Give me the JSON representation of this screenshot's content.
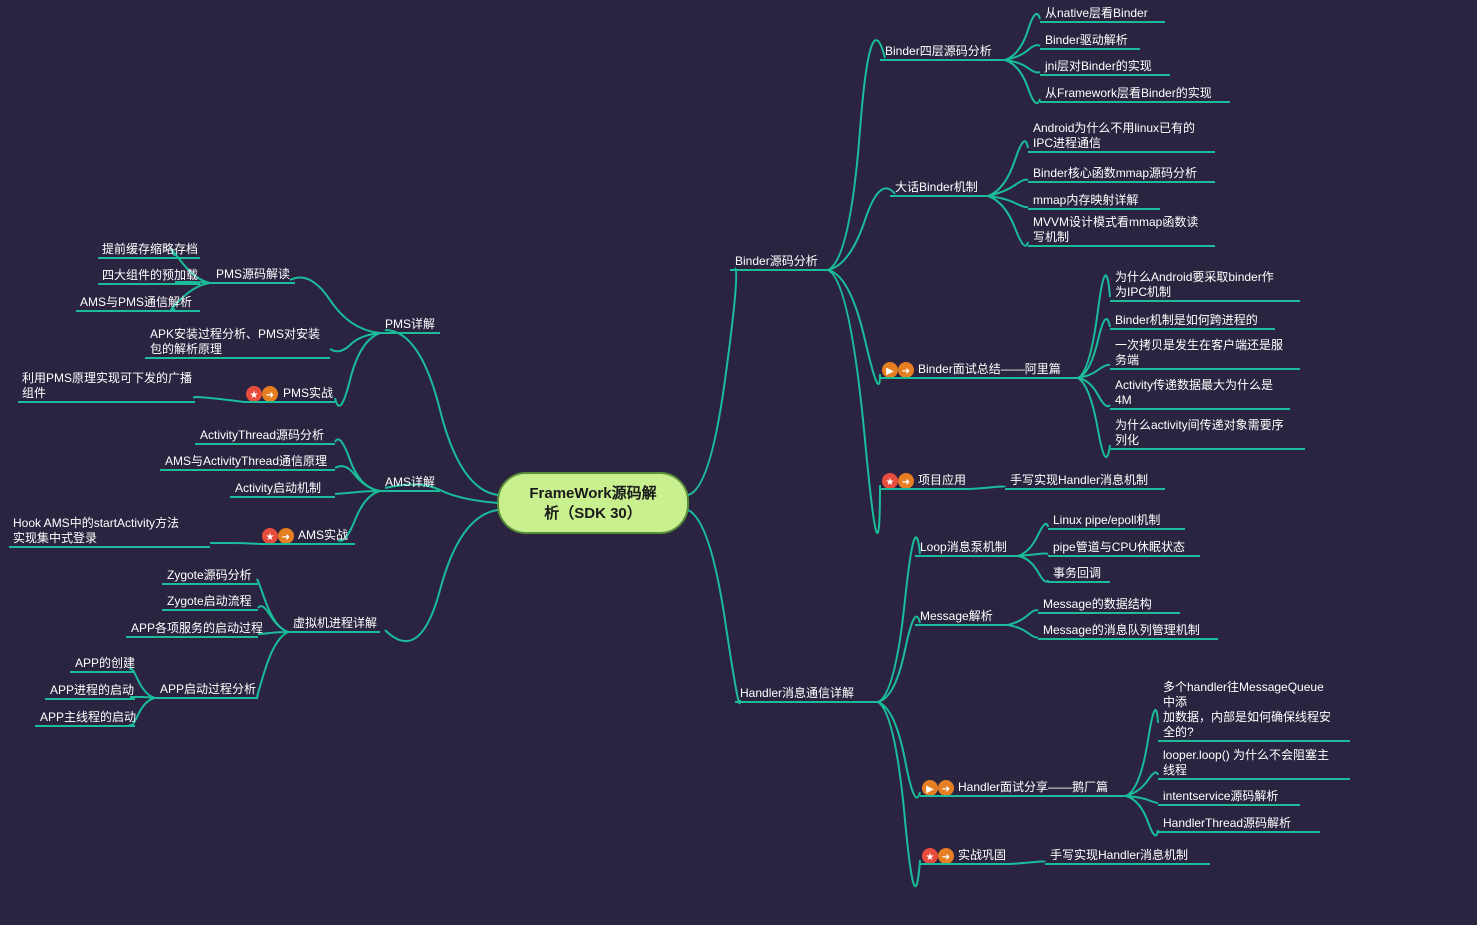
{
  "central": {
    "line1": "FrameWork源码解",
    "line2": "析（SDK 30）"
  },
  "left": {
    "pms": {
      "title": "PMS详解",
      "b1": {
        "title": "PMS源码解读",
        "items": [
          "提前缓存缩略存档",
          "四大组件的预加载",
          "AMS与PMS通信解析"
        ]
      },
      "b2": {
        "title": "APK安装过程分析、PMS对安装包的解析原理"
      },
      "b3": {
        "title": "PMS实战",
        "items": [
          "利用PMS原理实现可下发的广播组件"
        ]
      }
    },
    "ams": {
      "title": "AMS详解",
      "b1": {
        "items": [
          "ActivityThread源码分析",
          "AMS与ActivityThread通信原理",
          "Activity启动机制"
        ]
      },
      "b2": {
        "title": "AMS实战",
        "items": [
          "Hook AMS中的startActivity方法实现集中式登录"
        ]
      }
    },
    "vm": {
      "title": "虚拟机进程详解",
      "b1": {
        "items": [
          "Zygote源码分析",
          "Zygote启动流程",
          "APP各项服务的启动过程"
        ]
      },
      "b2": {
        "title": "APP启动过程分析",
        "items": [
          "APP的创建",
          "APP进程的启动",
          "APP主线程的启动"
        ]
      }
    }
  },
  "right": {
    "binder": {
      "title": "Binder源码分析",
      "b1": {
        "title": "Binder四层源码分析",
        "items": [
          "从native层看Binder",
          "Binder驱动解析",
          "jni层对Binder的实现",
          "从Framework层看Binder的实现"
        ]
      },
      "b2": {
        "title": "大话Binder机制",
        "items": [
          "Android为什么不用linux已有的IPC进程通信",
          "Binder核心函数mmap源码分析",
          "mmap内存映射详解",
          "MVVM设计模式看mmap函数读写机制"
        ]
      },
      "b3": {
        "title": "Binder面试总结——阿里篇",
        "items": [
          "为什么Android要采取binder作为IPC机制",
          "Binder机制是如何跨进程的",
          "一次拷贝是发生在客户端还是服务端",
          "Activity传递数据最大为什么是4M",
          "为什么activity间传递对象需要序列化"
        ]
      },
      "b4": {
        "title": "项目应用",
        "items": [
          "手写实现Handler消息机制"
        ]
      }
    },
    "handler": {
      "title": "Handler消息通信详解",
      "b1": {
        "title": "Loop消息泵机制",
        "items": [
          "Linux pipe/epoll机制",
          "pipe管道与CPU休眠状态",
          "事务回调"
        ]
      },
      "b2": {
        "title": "Message解析",
        "items": [
          "Message的数据结构",
          "Message的消息队列管理机制"
        ]
      },
      "b3": {
        "title": "Handler面试分享——鹅厂篇",
        "items": [
          "多个handler往MessageQueue中添\n加数据，内部是如何确保线程安全的?",
          "looper.loop() 为什么不会阻塞主线程",
          "intentservice源码解析",
          "HandlerThread源码解析"
        ]
      },
      "b4": {
        "title": "实战巩固",
        "items": [
          "手写实现Handler消息机制"
        ]
      }
    }
  }
}
